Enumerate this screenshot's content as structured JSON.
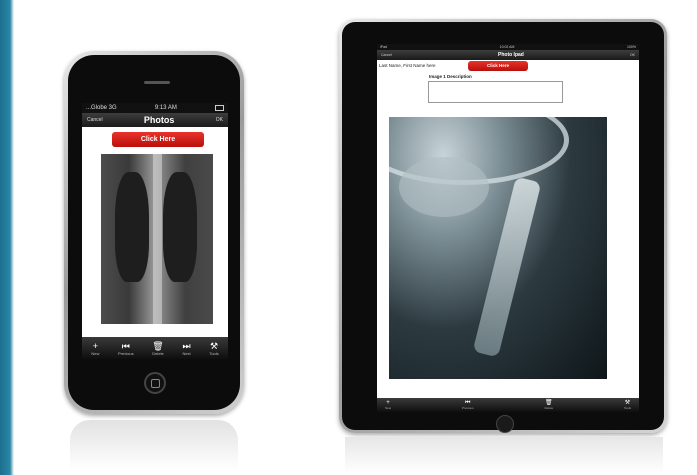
{
  "colors": {
    "accent_red": "#d41d16",
    "toolbar_dark": "#1a1a1a",
    "slide_edge": "#2a86a6"
  },
  "iphone": {
    "status": {
      "carrier": "...Globe 3G",
      "time": "9:13 AM"
    },
    "nav": {
      "left": "Cancel",
      "title": "Photos",
      "right": "OK"
    },
    "button_label": "Click Here",
    "toolbar": [
      {
        "icon": "+",
        "label": "New"
      },
      {
        "icon": "⏮",
        "label": "Previous"
      },
      {
        "icon": "🗑",
        "label": "Delete"
      },
      {
        "icon": "⏭",
        "label": "Next"
      },
      {
        "icon": "⚒",
        "label": "Tools"
      }
    ]
  },
  "ipad": {
    "status": {
      "device": "iPad",
      "time": "10:02 AM",
      "battery": "100%"
    },
    "nav": {
      "left": "Cancel",
      "title": "Photo Ipad",
      "right": "OK"
    },
    "name_text": "Last Name, First Name here",
    "button_label": "Click Here",
    "description_label": "Image 1 Description",
    "toolbar": [
      {
        "icon": "+",
        "label": "New"
      },
      {
        "icon": "⏮",
        "label": "Previous"
      },
      {
        "icon": "🗑",
        "label": "Delete"
      },
      {
        "icon": "⚒",
        "label": "Tools"
      }
    ]
  }
}
